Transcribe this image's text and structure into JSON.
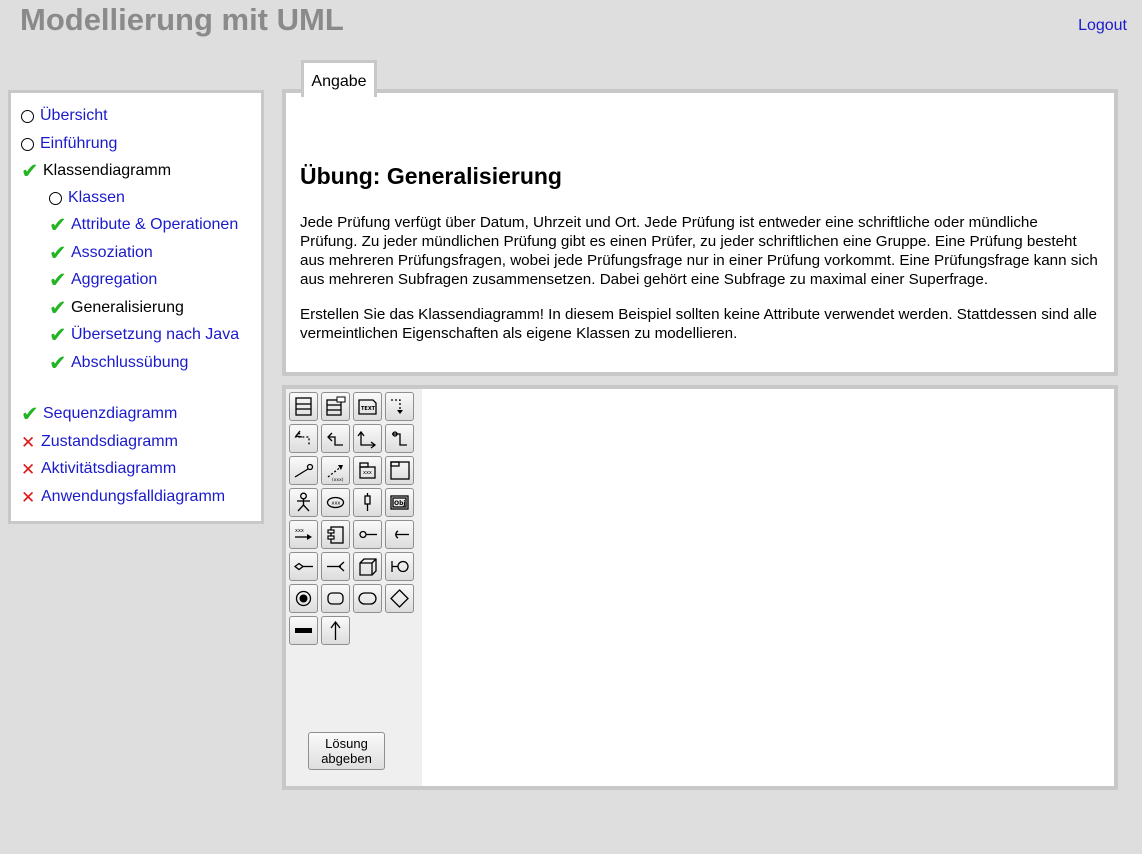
{
  "header": {
    "title": "Modellierung mit UML",
    "logout_label": "Logout"
  },
  "sidebar": {
    "items": [
      {
        "label": "Übersicht",
        "status": "open",
        "level": 0,
        "link": true
      },
      {
        "label": "Einführung",
        "status": "open",
        "level": 0,
        "link": true
      },
      {
        "label": "Klassendiagramm",
        "status": "done",
        "level": 0,
        "link": false
      },
      {
        "label": "Klassen",
        "status": "open",
        "level": 1,
        "link": true
      },
      {
        "label": "Attribute & Operationen",
        "status": "done",
        "level": 1,
        "link": true
      },
      {
        "label": "Assoziation",
        "status": "done",
        "level": 1,
        "link": true
      },
      {
        "label": "Aggregation",
        "status": "done",
        "level": 1,
        "link": true
      },
      {
        "label": "Generalisierung",
        "status": "done",
        "level": 1,
        "link": false
      },
      {
        "label": "Übersetzung nach Java",
        "status": "done",
        "level": 1,
        "link": true
      },
      {
        "label": "Abschlussübung",
        "status": "done",
        "level": 1,
        "link": true
      },
      {
        "label": "Sequenzdiagramm",
        "status": "done",
        "level": 0,
        "link": true
      },
      {
        "label": "Zustandsdiagramm",
        "status": "failed",
        "level": 0,
        "link": true
      },
      {
        "label": "Aktivitätsdiagramm",
        "status": "failed",
        "level": 0,
        "link": true
      },
      {
        "label": "Anwendungsfalldiagramm",
        "status": "failed",
        "level": 0,
        "link": true
      }
    ]
  },
  "tabs": [
    {
      "label": "Angabe",
      "active": true
    }
  ],
  "exercise": {
    "title": "Übung: Generalisierung",
    "paragraph1": "Jede Prüfung verfügt über Datum, Uhrzeit und Ort. Jede Prüfung ist entweder eine schriftliche oder mündliche Prüfung. Zu jeder mündlichen Prüfung gibt es einen Prüfer, zu jeder schriftlichen eine Gruppe. Eine Prüfung besteht aus mehreren Prüfungsfragen, wobei jede Prüfungsfrage nur in einer Prüfung vorkommt. Eine Prüfungsfrage kann sich aus mehreren Subfragen zusammensetzen. Dabei gehört eine Subfrage zu maximal einer Superfrage.",
    "paragraph2": "Erstellen Sie das Klassendiagramm! In diesem Beispiel sollten keine Attribute verwendet werden. Stattdessen sind alle vermeintlichen Eigenschaften als eigene Klassen zu modellieren."
  },
  "editor": {
    "tools": [
      "class-icon",
      "class-template-icon",
      "text-note-icon",
      "message-arrow-icon",
      "self-message-icon",
      "association-up-icon",
      "association-down-icon",
      "association-step-icon",
      "link-icon",
      "dependency-icon",
      "package-icon",
      "package-frame-icon",
      "actor-icon",
      "use-case-icon",
      "lifeline-icon",
      "object-icon",
      "realization-arrow-icon",
      "component-icon",
      "provided-interface-icon",
      "required-interface-icon",
      "aggregation-icon",
      "required-socket-icon",
      "node-icon",
      "interface-ball-icon",
      "final-state-icon",
      "state-icon",
      "action-icon",
      "decision-icon",
      "fork-bar-icon",
      "flow-arrow-icon"
    ],
    "submit_line1": "Lösung",
    "submit_line2": "abgeben"
  }
}
